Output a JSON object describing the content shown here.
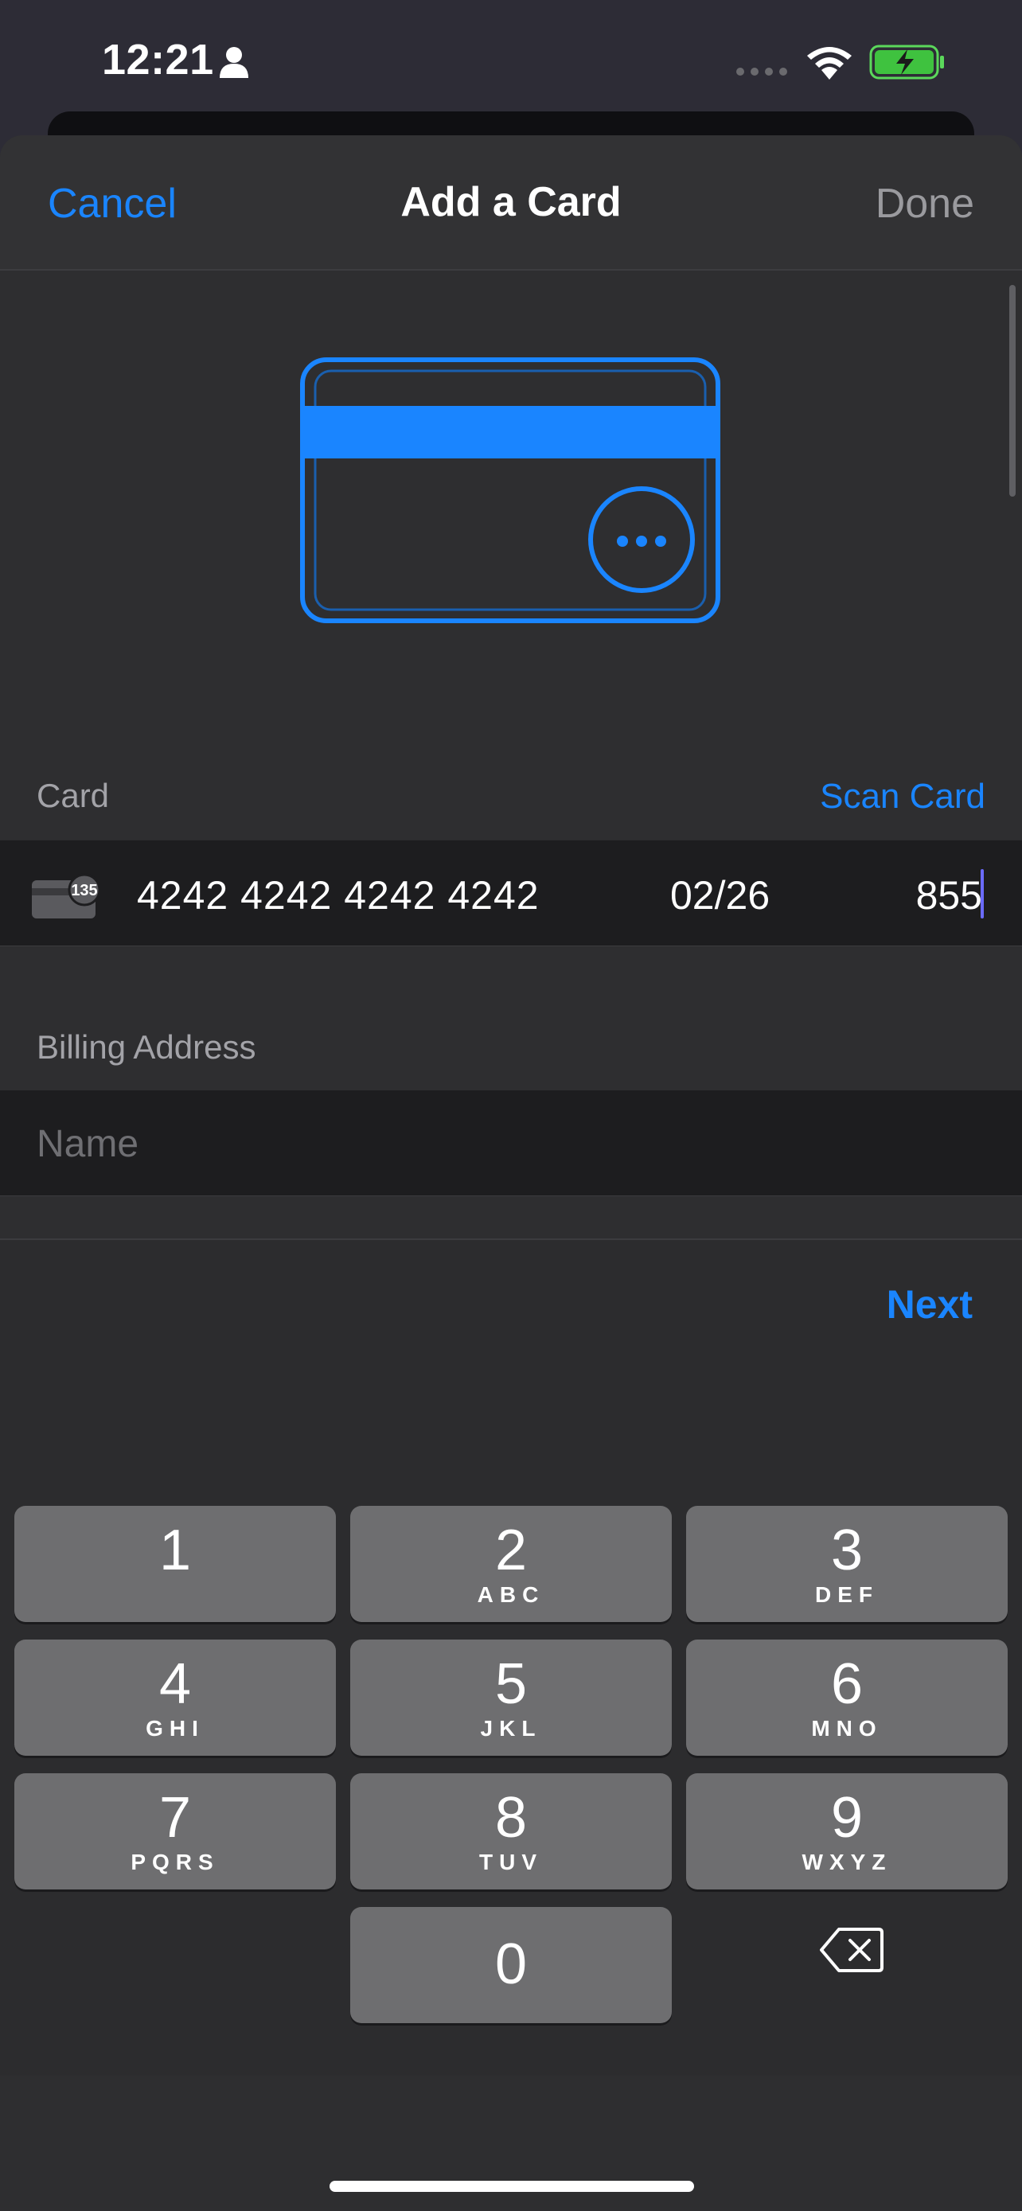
{
  "status_bar": {
    "time": "12:21"
  },
  "nav": {
    "cancel": "Cancel",
    "title": "Add a Card",
    "done": "Done"
  },
  "card_section": {
    "label": "Card",
    "scan_card": "Scan Card",
    "card_brand_badge": "135",
    "card_number": "4242 4242 4242 4242",
    "expiry": "02/26",
    "cvc": "855"
  },
  "billing": {
    "label": "Billing Address",
    "name_placeholder": "Name",
    "name_value": ""
  },
  "accessory": {
    "next": "Next"
  },
  "keypad": {
    "keys": [
      {
        "num": "1",
        "letters": ""
      },
      {
        "num": "2",
        "letters": "ABC"
      },
      {
        "num": "3",
        "letters": "DEF"
      },
      {
        "num": "4",
        "letters": "GHI"
      },
      {
        "num": "5",
        "letters": "JKL"
      },
      {
        "num": "6",
        "letters": "MNO"
      },
      {
        "num": "7",
        "letters": "PQRS"
      },
      {
        "num": "8",
        "letters": "TUV"
      },
      {
        "num": "9",
        "letters": "WXYZ"
      },
      {
        "num": "0",
        "letters": ""
      }
    ]
  },
  "colors": {
    "accent": "#1a85ff",
    "background": "#2e2e30",
    "field": "#1d1d1f",
    "key": "#6e6e70"
  }
}
